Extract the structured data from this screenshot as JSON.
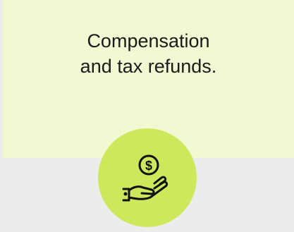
{
  "card": {
    "line1": "Compensation",
    "line2": "and tax refunds."
  },
  "icon": {
    "name": "hand-coin-icon",
    "coin_symbol": "$"
  },
  "colors": {
    "background": "#ececec",
    "card": "#f1f8d2",
    "accent": "#cde85a",
    "text": "#1b1b1b"
  }
}
